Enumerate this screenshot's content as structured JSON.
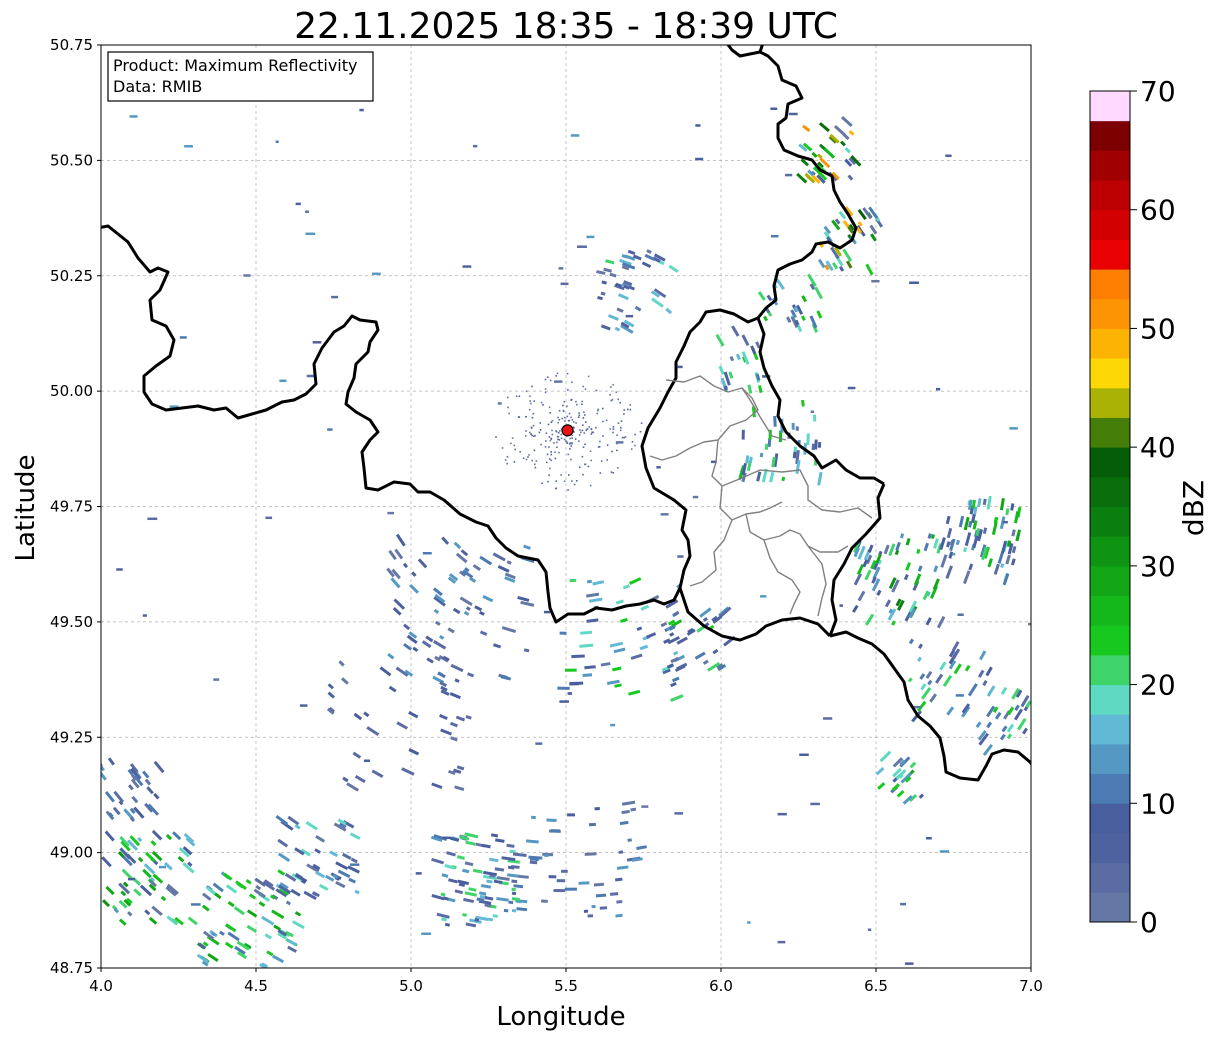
{
  "title": "22.11.2025 18:35 - 18:39 UTC",
  "info_box": {
    "line1": "Product: Maximum Reflectivity",
    "line2": "Data: RMIB"
  },
  "axes": {
    "xlabel": "Longitude",
    "ylabel": "Latitude",
    "xlim": [
      4.0,
      7.0
    ],
    "ylim": [
      48.75,
      50.75
    ],
    "x_ticks": [
      "4.0",
      "4.5",
      "5.0",
      "5.5",
      "6.0",
      "6.5",
      "7.0"
    ],
    "y_ticks": [
      "50.75",
      "50.50",
      "50.25",
      "50.00",
      "49.75",
      "49.50",
      "49.25",
      "49.00",
      "48.75"
    ],
    "grid": true
  },
  "radar_site": {
    "lon": 5.505,
    "lat": 49.915,
    "color": "#e8141a"
  },
  "colorbar": {
    "label": "dBZ",
    "min": 0,
    "max": 70,
    "step": 2.5,
    "ticks": [
      "0",
      "10",
      "20",
      "30",
      "40",
      "50",
      "60",
      "70"
    ],
    "colors": [
      "#6577a5",
      "#5a6ca3",
      "#4f62a0",
      "#485e9d",
      "#4c7ab2",
      "#5598c3",
      "#62b9d6",
      "#5fd9c1",
      "#3ed46a",
      "#17c91f",
      "#14b81b",
      "#12a617",
      "#0f9313",
      "#0b7e10",
      "#0a6e0d",
      "#065d07",
      "#447d07",
      "#a9b205",
      "#fdd806",
      "#fcb304",
      "#fc9404",
      "#fc7f03",
      "#e80002",
      "#d30002",
      "#bd0002",
      "#a10002",
      "#7d0001",
      "#ffd9ff",
      "#ffaaff",
      "#ff77ff",
      "#f23bf2"
    ]
  },
  "chart_data": {
    "type": "heatmap",
    "title": "22.11.2025 18:35 - 18:39 UTC",
    "xlabel": "Longitude",
    "ylabel": "Latitude",
    "units": "dBZ",
    "xlim": [
      4.0,
      7.0
    ],
    "ylim": [
      48.75,
      50.75
    ],
    "value_range": [
      0,
      70
    ]
  }
}
